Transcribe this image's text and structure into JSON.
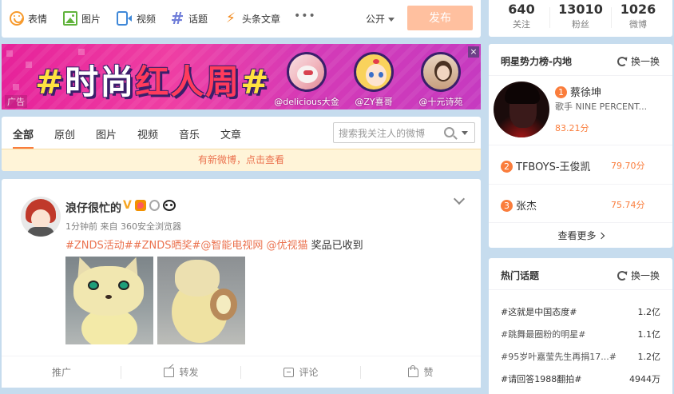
{
  "publisher": {
    "tools": [
      {
        "label": "表情",
        "icon": "smile-icon"
      },
      {
        "label": "图片",
        "icon": "image-icon"
      },
      {
        "label": "视频",
        "icon": "video-icon"
      },
      {
        "label": "话题",
        "icon": "hash-icon"
      },
      {
        "label": "头条文章",
        "icon": "bolt-icon"
      }
    ],
    "more": "•••",
    "scope": "公开",
    "post_label": "发布"
  },
  "banner": {
    "hash1": "#",
    "title_a": "时尚",
    "title_b": "红人周",
    "hash2": "#",
    "ad_tag": "广告",
    "close": "×",
    "stars": [
      {
        "name": "@delicious大金"
      },
      {
        "name": "@ZY喜哥"
      },
      {
        "name": "@十元诗苑"
      }
    ]
  },
  "filter": {
    "tabs": [
      "全部",
      "原创",
      "图片",
      "视频",
      "音乐",
      "文章"
    ],
    "search_placeholder": "搜索我关注人的微博",
    "new_notice": "有新微博，点击查看"
  },
  "feed": {
    "nickname": "浪仔很忙的",
    "meta": "1分钟前 来自 360安全浏览器",
    "links": [
      "#ZNDS活动#",
      "#ZNDS晒奖#",
      "@智能电视网",
      " @优视猫"
    ],
    "text_tail": " 奖品已收到",
    "actions": {
      "promote": "推广",
      "share": "转发",
      "comment": "评论",
      "like": "赞"
    }
  },
  "stats": [
    {
      "num": "640",
      "label": "关注"
    },
    {
      "num": "13010",
      "label": "粉丝"
    },
    {
      "num": "1026",
      "label": "微博"
    }
  ],
  "rank": {
    "title": "明星势力榜-内地",
    "refresh": "换一换",
    "top": {
      "no": "1",
      "name": "蔡徐坤",
      "desc": "歌手 NINE PERCENT...",
      "score": "83.21分"
    },
    "rows": [
      {
        "no": "2",
        "name": "TFBOYS-王俊凯",
        "score": "79.70分"
      },
      {
        "no": "3",
        "name": "张杰",
        "score": "75.74分"
      }
    ],
    "more": "查看更多"
  },
  "topics": {
    "title": "热门话题",
    "refresh": "换一换",
    "items": [
      {
        "title": "#这就是中国态度#",
        "count": "1.2亿"
      },
      {
        "title": "#跳舞最圈粉的明星#",
        "count": "1.1亿"
      },
      {
        "title": "#95岁叶嘉莹先生再捐17...#",
        "count": "1.2亿"
      },
      {
        "title": "#请回答1988翻拍#",
        "count": "4944万"
      }
    ]
  },
  "colors": {
    "accent": "#fa7d3c",
    "post_button": "#ffc09f",
    "link": "#eb7350",
    "page_bg": "#c6dcee"
  }
}
